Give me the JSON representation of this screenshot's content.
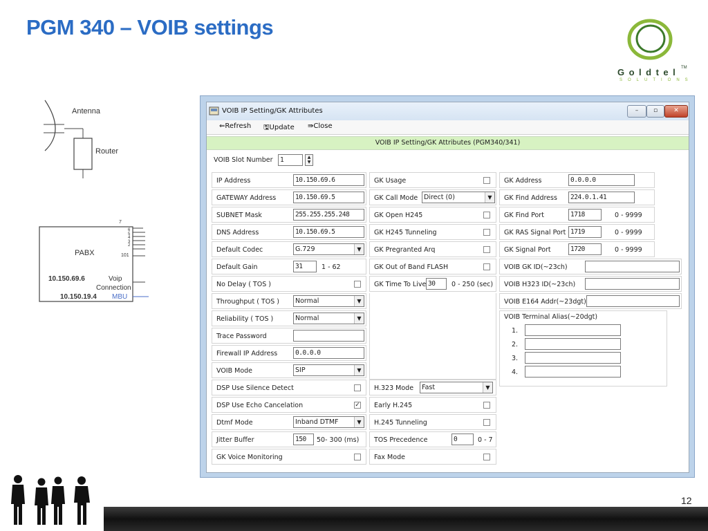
{
  "slide": {
    "title": "PGM 340 – VOIB settings",
    "page_number": "12"
  },
  "logo": {
    "name": "Goldtel",
    "tm": "TM",
    "tagline": "SOLUTIONS",
    "accent": "#8bb83a"
  },
  "diagram": {
    "antenna": "Antenna",
    "router": "Router",
    "pabx": "PABX",
    "port_top": "7",
    "ports": [
      "6",
      "5",
      "4",
      "3",
      "2"
    ],
    "port_bottom": "101",
    "voip_ip": "10.150.69.6",
    "voip_label": "Voip",
    "connection_label": "Connection",
    "mbu_ip": "10.150.19.4",
    "mbu_label": "MBU"
  },
  "window": {
    "title": "VOIB IP Setting/GK Attributes",
    "toolbar": {
      "refresh": "Refresh",
      "update": "Update",
      "close": "Close"
    },
    "header": "VOIB IP Setting/GK Attributes (PGM340/341)",
    "slot": {
      "label": "VOIB Slot Number",
      "value": "1"
    },
    "col1": {
      "ip_address": {
        "label": "IP Address",
        "value": "10.150.69.6"
      },
      "gateway": {
        "label": "GATEWAY Address",
        "value": "10.150.69.5"
      },
      "subnet": {
        "label": "SUBNET Mask",
        "value": "255.255.255.248"
      },
      "dns": {
        "label": "DNS Address",
        "value": "10.150.69.5"
      },
      "codec": {
        "label": "Default Codec",
        "value": "G.729"
      },
      "gain": {
        "label": "Default Gain",
        "value": "31",
        "range": "1 - 62"
      },
      "no_delay": {
        "label": "No Delay ( TOS )",
        "checked": false
      },
      "throughput": {
        "label": "Throughput ( TOS )",
        "value": "Normal"
      },
      "reliability": {
        "label": "Reliability ( TOS )",
        "value": "Normal"
      },
      "trace_password": {
        "label": "Trace Password",
        "value": ""
      },
      "firewall": {
        "label": "Firewall IP Address",
        "value": "0.0.0.0"
      },
      "voib_mode": {
        "label": "VOIB Mode",
        "value": "SIP"
      },
      "silence": {
        "label": "DSP Use Silence Detect",
        "checked": false
      },
      "echo": {
        "label": "DSP Use Echo Cancelation",
        "checked": true
      },
      "dtmf": {
        "label": "Dtmf Mode",
        "value": "Inband DTMF"
      },
      "jitter": {
        "label": "Jitter Buffer",
        "value": "150",
        "range": "50- 300 (ms)"
      },
      "gk_voice": {
        "label": "GK Voice Monitoring",
        "checked": false
      }
    },
    "col2": {
      "gk_usage": {
        "label": "GK Usage",
        "checked": false
      },
      "gk_call_mode": {
        "label": "GK Call Mode",
        "value": "Direct (0)"
      },
      "gk_open_h245": {
        "label": "GK Open H245",
        "checked": false
      },
      "gk_h245_tunneling": {
        "label": "GK H245 Tunneling",
        "checked": false
      },
      "gk_pregranted": {
        "label": "GK Pregranted Arq",
        "checked": false
      },
      "gk_oob_flash": {
        "label": "GK Out of Band FLASH",
        "checked": false
      },
      "gk_ttl": {
        "label": "GK Time To Live",
        "value": "30",
        "range": "0 - 250 (sec)"
      },
      "h323_mode": {
        "label": "H.323 Mode",
        "value": "Fast"
      },
      "early_h245": {
        "label": "Early H.245",
        "checked": false
      },
      "h245_tunneling": {
        "label": "H.245 Tunneling",
        "checked": false
      },
      "tos_precedence": {
        "label": "TOS Precedence",
        "value": "0",
        "range": "0 - 7"
      },
      "fax_mode": {
        "label": "Fax Mode",
        "checked": false
      }
    },
    "col3": {
      "gk_address": {
        "label": "GK Address",
        "value": "0.0.0.0"
      },
      "gk_find_address": {
        "label": "GK Find Address",
        "value": "224.0.1.41"
      },
      "gk_find_port": {
        "label": "GK Find Port",
        "value": "1718",
        "range": "0 - 9999"
      },
      "gk_ras_port": {
        "label": "GK RAS Signal Port",
        "value": "1719",
        "range": "0 - 9999"
      },
      "gk_signal_port": {
        "label": "GK Signal Port",
        "value": "1720",
        "range": "0 - 9999"
      },
      "voib_gk_id": {
        "label": "VOIB GK ID(~23ch)",
        "value": ""
      },
      "voib_h323_id": {
        "label": "VOIB H323 ID(~23ch)",
        "value": ""
      },
      "voib_e164": {
        "label": "VOIB E164 Addr(~23dgt)",
        "value": ""
      },
      "terminal_alias": {
        "label": "VOIB Terminal Alias(~20dgt)",
        "items": [
          "1.",
          "2.",
          "3.",
          "4."
        ]
      }
    }
  }
}
